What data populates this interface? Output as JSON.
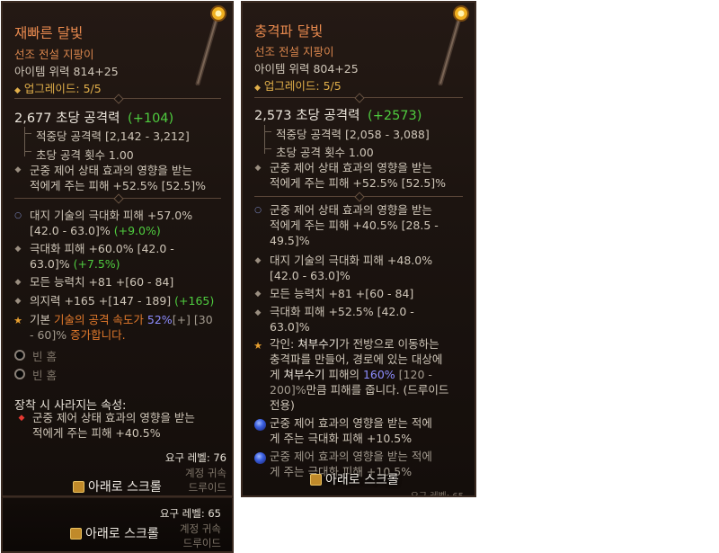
{
  "left": {
    "name": "재빠른 달빛",
    "type": "선조 전설 지팡이",
    "item_power": "아이템 위력 814+25",
    "upgrades": "업그레이드: 5/5",
    "dps_value": "2,677 초당 공격력",
    "dps_delta": "(+104)",
    "damage_per_hit": "적중당 공격력 [2,142 - 3,212]",
    "attacks_per_second": "초당 공격 횟수 1.00",
    "implicit_a": "군중 제어 상태 효과의 영향을 받는",
    "implicit_b": "적에게 주는 피해 +52.5% [52.5]%",
    "affixes": [
      {
        "bullet": "○",
        "a": "대지 기술의 극대화 피해 +57.0%",
        "b": "[42.0 - 63.0]% ",
        "b_green": "(+9.0%)"
      },
      {
        "bullet": "◆",
        "a": "극대화 피해 +60.0% [42.0 -",
        "b": "63.0]% ",
        "b_green": "(+7.5%)"
      },
      {
        "bullet": "◆",
        "a": "모든 능력치 +81 +[60 - 84]"
      },
      {
        "bullet": "◆",
        "a": "의지력 +165 +[147 - 189] ",
        "a_green": "(+165)"
      }
    ],
    "aspect": {
      "p1": "기본 ",
      "p2": "기술의 공격 속도가 ",
      "p3": "52%",
      "p4": "[+] [30",
      "l2a": "- 60]% ",
      "l2b": "증가합니다."
    },
    "socket1": "빈 홈",
    "socket2": "빈 홈",
    "equip_header": "장착 시 사라지는 속성:",
    "lost_a": "군중 제어 상태 효과의 영향을 받는",
    "lost_b": "적에게 주는 피해 +40.5%",
    "req_level": "요구 레벨: 76",
    "account_bound": "계정 귀속",
    "class": "드루이드",
    "scroll": "아래로 스크롤"
  },
  "right": {
    "name": "충격파 달빛",
    "type": "선조 전설 지팡이",
    "item_power": "아이템 위력 804+25",
    "upgrades": "업그레이드: 5/5",
    "dps_value": "2,573 초당 공격력",
    "dps_delta": "(+2573)",
    "damage_per_hit": "적중당 공격력 [2,058 - 3,088]",
    "attacks_per_second": "초당 공격 횟수 1.00",
    "implicit_a": "군중 제어 상태 효과의 영향을 받는",
    "implicit_b": "적에게 주는 피해 +52.5% [52.5]%",
    "affixes": [
      {
        "bullet": "○",
        "a": "군중 제어 상태 효과의 영향을 받는",
        "b": "적에게 주는 피해 +40.5% [28.5 -",
        "c": "49.5]%"
      },
      {
        "bullet": "◆",
        "a": "대지 기술의 극대화 피해 +48.0%",
        "b": "[42.0 - 63.0]%"
      },
      {
        "bullet": "◆",
        "a": "모든 능력치 +81 +[60 - 84]"
      },
      {
        "bullet": "◆",
        "a": "극대화 피해 +52.5% [42.0 -",
        "b": "63.0]%"
      }
    ],
    "aspect": {
      "l1a": "각인: ",
      "l1b": "쳐부수기",
      "l1c": "가 전방으로 이동하는",
      "l2": "충격파를 만들어, 경로에 있는 대상에",
      "l3a": "게 ",
      "l3b": "쳐부수기",
      "l3c": " 피해의 ",
      "l3d": "160%",
      "l3e": " [120 -",
      "l4a": "200]%",
      "l4b": "만큼 피해를 줍니다. (드루이드",
      "l5": "전용)"
    },
    "gem1_a": "군중 제어 효과의 영향을 받는 적에",
    "gem1_b": "게 주는 극대화 피해 +10.5%",
    "gem2_a": "군중 제어 효과의 영향을 받는 적에",
    "gem2_b": "게 주는 극대화 피해 +10.5%",
    "req_level_partial": "요구 레벨: 65",
    "scroll": "아래로 스크롤"
  },
  "bottom": {
    "req_level": "요구 레벨: 65",
    "account_bound": "계정 귀속",
    "class": "드루이드",
    "scroll": "아래로 스크롤"
  }
}
